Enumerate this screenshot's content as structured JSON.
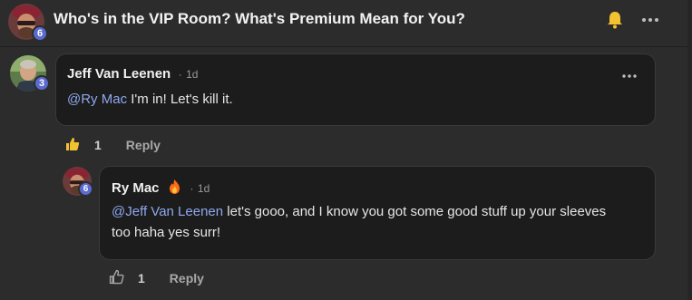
{
  "header": {
    "title": "Who's in the VIP Room? What's Premium Mean for You?",
    "avatar_badge": "6",
    "bell_icon": "bell-icon",
    "more_icon": "more-horizontal-icon"
  },
  "comments": [
    {
      "author": "Jeff Van Leenen",
      "separator": "·",
      "time": "1d",
      "avatar_badge": "3",
      "mention": "@Ry Mac",
      "text": " I'm in! Let's kill it.",
      "likes": "1",
      "reply_label": "Reply",
      "liked": true
    },
    {
      "author": "Ry Mac",
      "separator": "·",
      "time": "1d",
      "avatar_badge": "6",
      "mention": "@Jeff Van Leenen",
      "text_line1": " let's gooo, and I know you got some good stuff up your sleeves",
      "text_line2": "too haha yes surr!",
      "likes": "1",
      "reply_label": "Reply",
      "liked": false
    }
  ],
  "colors": {
    "background": "#2c2c2c",
    "bubble": "#1c1c1c",
    "mention": "#8fa8ee",
    "badge": "#5a6acf",
    "like_active": "#f2c230"
  }
}
